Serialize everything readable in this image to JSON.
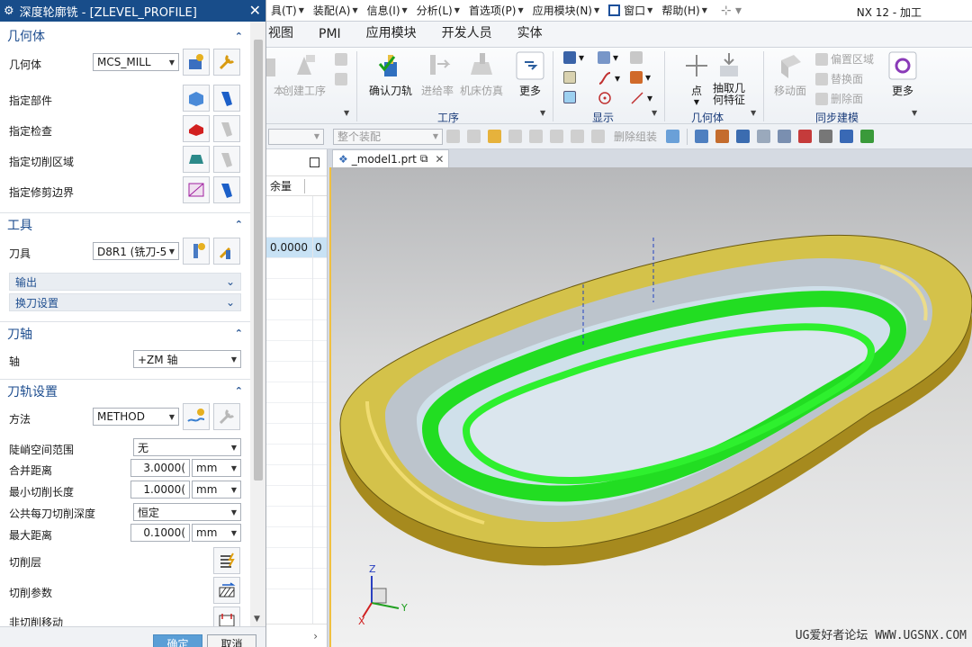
{
  "dialog": {
    "title": "深度轮廓铣 - [ZLEVEL_PROFILE]",
    "sections": {
      "geometry": {
        "title": "几何体",
        "geometry_label": "几何体",
        "geometry_value": "MCS_MILL",
        "specify_part": "指定部件",
        "specify_check": "指定检查",
        "specify_cut_area": "指定切削区域",
        "specify_trim": "指定修剪边界"
      },
      "tool": {
        "title": "工具",
        "tool_label": "刀具",
        "tool_value": "D8R1 (铣刀-5",
        "output": "输出",
        "tool_change": "换刀设置"
      },
      "axis": {
        "title": "刀轴",
        "axis_label": "轴",
        "axis_value": "+ZM 轴"
      },
      "path": {
        "title": "刀轨设置",
        "method_label": "方法",
        "method_value": "METHOD",
        "steep_label": "陡峭空间范围",
        "steep_value": "无",
        "merge_label": "合并距离",
        "merge_value": "3.0000(",
        "min_cut_label": "最小切削长度",
        "min_cut_value": "1.0000(",
        "depth_label": "公共每刀切削深度",
        "depth_value": "恒定",
        "max_dist_label": "最大距离",
        "max_dist_value": "0.1000(",
        "unit": "mm",
        "cut_levels": "切削层",
        "cut_params": "切削参数",
        "non_cut": "非切削移动"
      }
    },
    "ok": "确定",
    "cancel": "取消"
  },
  "menubar": {
    "items": [
      "具(T)",
      "装配(A)",
      "信息(I)",
      "分析(L)",
      "首选项(P)",
      "应用模块(N)",
      "窗口",
      "帮助(H)"
    ],
    "app_title": "NX 12 - 加工"
  },
  "ribbon_tabs": [
    "视图",
    "PMI",
    "应用模块",
    "开发人员",
    "实体"
  ],
  "ribbon": {
    "create_op_cut": "本",
    "create_op": "创建工序",
    "confirm_path": "确认刀轨",
    "feed_rate": "进给率",
    "machine_sim": "机床仿真",
    "more": "更多",
    "group_operation": "工序",
    "group_display": "显示",
    "point": "点",
    "extract_line1": "抽取几",
    "extract_line2": "何特征",
    "group_geometry": "几何体",
    "move_face": "移动面",
    "offset_region": "偏置区域",
    "replace_face": "替换面",
    "delete_face": "删除面",
    "more2": "更多",
    "group_sync": "同步建模"
  },
  "toolbar2": {
    "assembly_filter": "整个装配",
    "delete_group": "删除组装"
  },
  "navigator": {
    "col_header": "余量",
    "row_value": "0.0000",
    "row_value_clip": "0"
  },
  "graphics": {
    "file_tab": "_model1.prt",
    "watermark": "UG爱好者论坛 WWW.UGSNX.COM",
    "triad": {
      "x": "X",
      "y": "Y",
      "z": "Z"
    }
  }
}
